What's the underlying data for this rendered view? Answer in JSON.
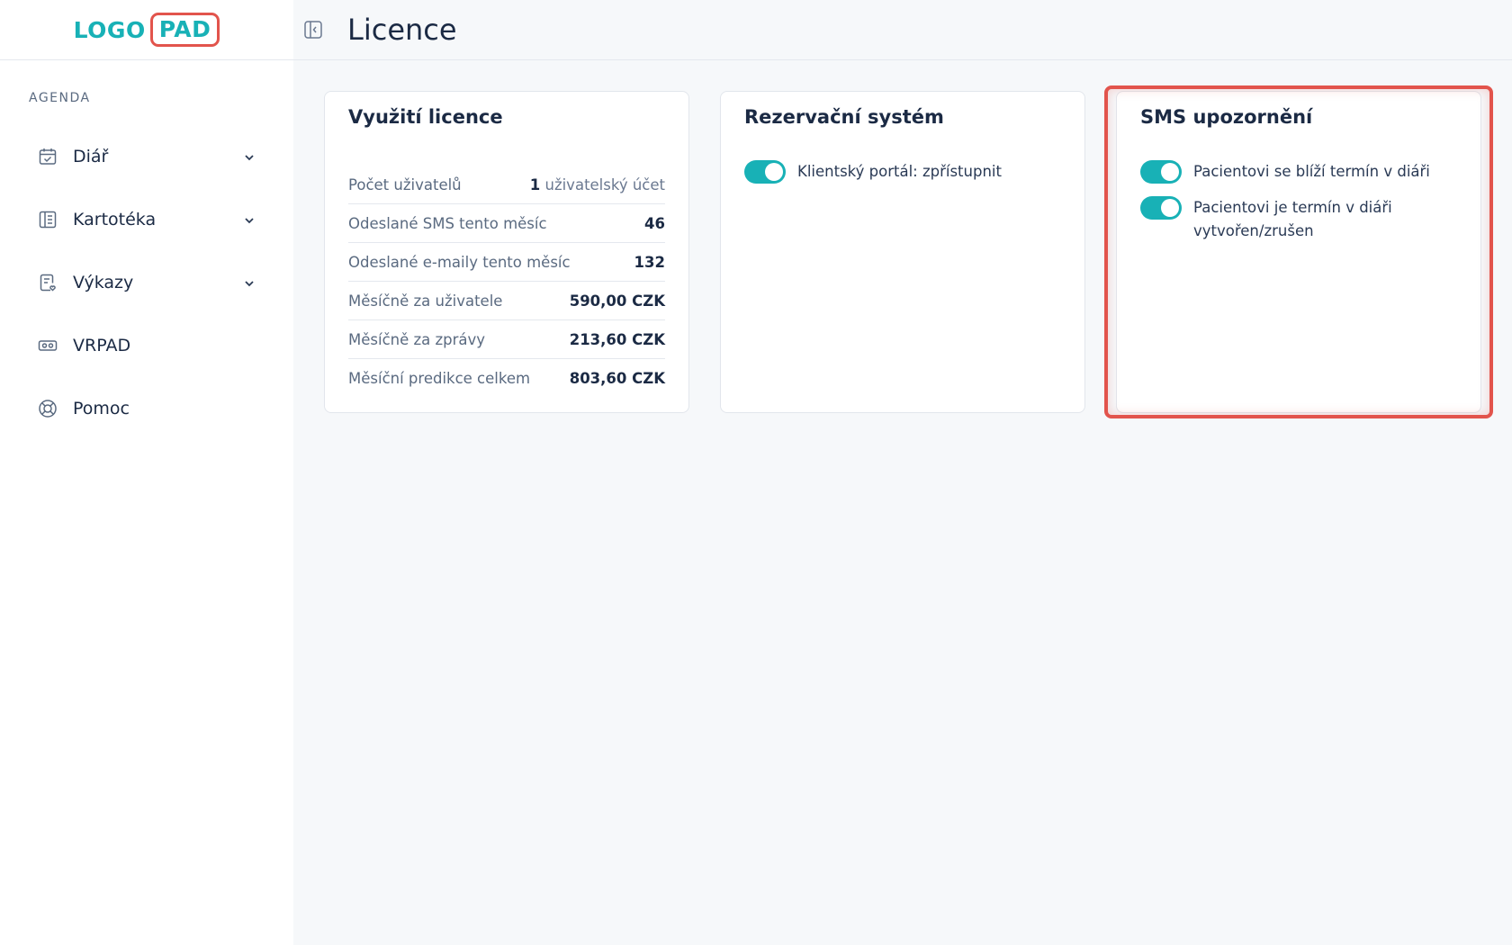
{
  "logo": {
    "text": "LOGO",
    "pad": "PAD"
  },
  "sidebar": {
    "section_title": "AGENDA",
    "items": [
      {
        "label": "Diář",
        "icon": "calendar-check-icon",
        "has_chevron": true
      },
      {
        "label": "Kartotéka",
        "icon": "card-index-icon",
        "has_chevron": true
      },
      {
        "label": "Výkazy",
        "icon": "report-icon",
        "has_chevron": true
      },
      {
        "label": "VRPAD",
        "icon": "vr-headset-icon",
        "has_chevron": false
      },
      {
        "label": "Pomoc",
        "icon": "lifebuoy-icon",
        "has_chevron": false
      }
    ]
  },
  "header": {
    "title": "Licence"
  },
  "cards": {
    "license": {
      "title": "Využití licence",
      "rows": [
        {
          "label": "Počet uživatelů",
          "value_num": "1",
          "value_unit": "uživatelský účet"
        },
        {
          "label": "Odeslané SMS tento měsíc",
          "value_num": "46",
          "value_unit": ""
        },
        {
          "label": "Odeslané e-maily tento měsíc",
          "value_num": "132",
          "value_unit": ""
        },
        {
          "label": "Měsíčně za uživatele",
          "value_num": "590,00 CZK",
          "value_unit": ""
        },
        {
          "label": "Měsíčně za zprávy",
          "value_num": "213,60 CZK",
          "value_unit": ""
        },
        {
          "label": "Měsíční predikce celkem",
          "value_num": "803,60 CZK",
          "value_unit": ""
        }
      ]
    },
    "reservation": {
      "title": "Rezervační systém",
      "toggles": [
        {
          "label": "Klientský portál: zpřístupnit",
          "on": true
        }
      ]
    },
    "sms": {
      "title": "SMS upozornění",
      "toggles": [
        {
          "label": "Pacientovi se blíží termín v diáři",
          "on": true
        },
        {
          "label": "Pacientovi je termín v diáři vytvořen/zrušen",
          "on": true
        }
      ]
    }
  },
  "colors": {
    "accent": "#18b1b6",
    "highlight": "#e2544c",
    "text": "#1b2a44"
  }
}
